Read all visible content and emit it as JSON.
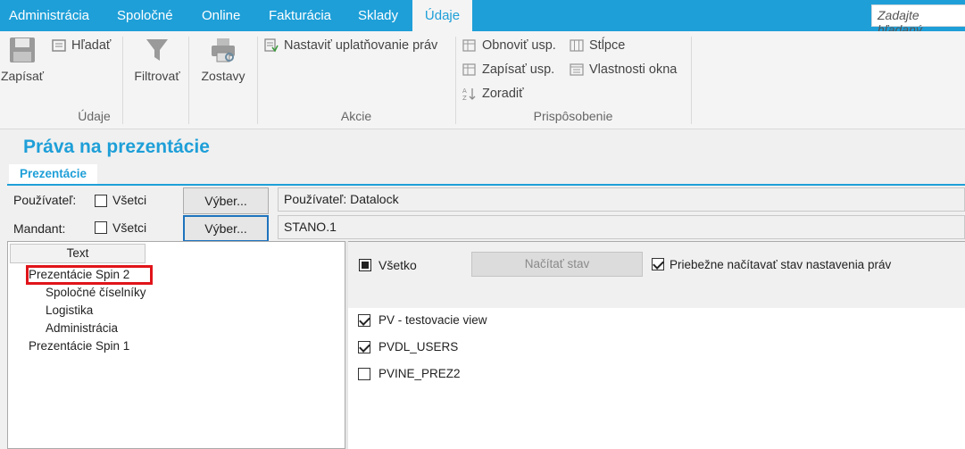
{
  "menu": {
    "items": [
      "Administrácia",
      "Spoločné",
      "Online",
      "Fakturácia",
      "Sklady",
      "Údaje"
    ],
    "active": "Údaje",
    "search_placeholder": "Zadajte hľadaný"
  },
  "ribbon": {
    "udaje": {
      "save": "Zapísať",
      "find": "Hľadať",
      "filter": "Filtrovať",
      "label": "Údaje"
    },
    "zostavy": "Zostavy",
    "akcie": {
      "set_rights": "Nastaviť uplatňovanie práv",
      "label": "Akcie"
    },
    "prisposobenie": {
      "refresh": "Obnoviť usp.",
      "write": "Zapísať usp.",
      "sort": "Zoradiť",
      "columns": "Stĺpce",
      "window_props": "Vlastnosti okna",
      "label": "Prispôsobenie"
    }
  },
  "page": {
    "title": "Práva na prezentácie",
    "tab": "Prezentácie"
  },
  "filters": {
    "user_label": "Používateľ:",
    "user_all_label": "Všetci",
    "user_all_checked": false,
    "user_button": "Výber...",
    "user_value": "Používateľ: Datalock",
    "client_label": "Mandant:",
    "client_all_label": "Všetci",
    "client_all_checked": false,
    "client_button": "Výber...",
    "client_value": "STANO.1"
  },
  "tree": {
    "header": "Text",
    "items": [
      {
        "label": "Prezentácie Spin 2",
        "level": 0
      },
      {
        "label": "Spoločné číselníky",
        "level": 1
      },
      {
        "label": "Logistika",
        "level": 1
      },
      {
        "label": "Administrácia",
        "level": 1
      },
      {
        "label": "Prezentácie Spin 1",
        "level": 0
      }
    ]
  },
  "rights": {
    "all_label": "Všetko",
    "load_button": "Načítať stav",
    "auto_load_label": "Priebežne načítavať stav nastavenia práv",
    "auto_load_checked": true,
    "items": [
      {
        "label": "PV - testovacie view",
        "checked": true
      },
      {
        "label": "PVDL_USERS",
        "checked": true
      },
      {
        "label": "PVINE_PREZ2",
        "checked": false
      }
    ]
  },
  "colors": {
    "accent": "#1e9fd8",
    "highlight": "#e0141a"
  }
}
